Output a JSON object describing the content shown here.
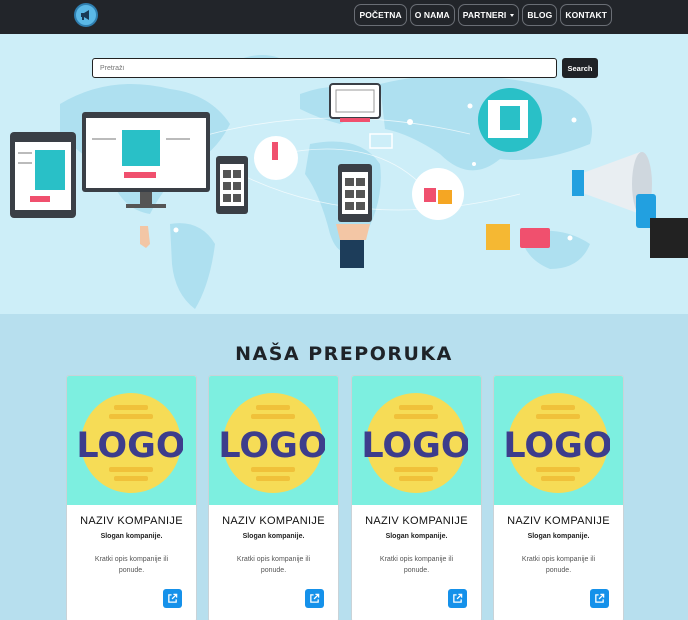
{
  "navbar": {
    "brand_icon": "megaphone-icon",
    "items": [
      {
        "label": "POČETNA"
      },
      {
        "label": "O NAMA"
      },
      {
        "label": "PARTNERI",
        "dropdown": true
      },
      {
        "label": "BLOG"
      },
      {
        "label": "KONTAKT"
      }
    ]
  },
  "hero": {
    "search_placeholder": "Pretraži",
    "search_button": "Search"
  },
  "recommend": {
    "title": "NAŠA PREPORUKA",
    "logo_text": "LOGO",
    "cards": [
      {
        "name": "NAZIV KOMPANIJE",
        "slogan": "Slogan kompanije.",
        "desc": "Kratki opis kompanije ili ponude.",
        "icon": "external-link-icon"
      },
      {
        "name": "NAZIV KOMPANIJE",
        "slogan": "Slogan kompanije.",
        "desc": "Kratki opis kompanije ili ponude.",
        "icon": "external-link-icon"
      },
      {
        "name": "NAZIV KOMPANIJE",
        "slogan": "Slogan kompanije.",
        "desc": "Kratki opis kompanije ili ponude.",
        "icon": "external-link-icon"
      },
      {
        "name": "NAZIV KOMPANIJE",
        "slogan": "Slogan kompanije.",
        "desc": "Kratki opis kompanije ili ponude.",
        "icon": "external-link-icon"
      }
    ]
  },
  "colors": {
    "navbar_bg": "#22252a",
    "hero_bg": "#cdeef8",
    "section_bg": "#b7dfee",
    "card_top_bg": "#7defe0",
    "logo_yellow": "#f6dc56",
    "logo_text": "#3d3d8c",
    "link_button": "#1591ea"
  }
}
